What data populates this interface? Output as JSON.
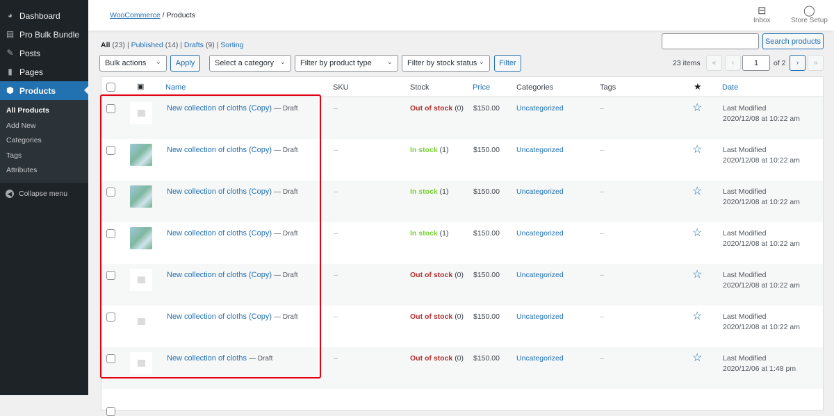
{
  "sidebar": {
    "items": [
      {
        "label": "Dashboard",
        "icon": "dashboard-icon"
      },
      {
        "label": "Pro Bulk Bundle",
        "icon": "bundle-icon"
      },
      {
        "label": "Posts",
        "icon": "pin-icon"
      },
      {
        "label": "Pages",
        "icon": "pages-icon"
      },
      {
        "label": "Products",
        "icon": "box-icon"
      }
    ],
    "submenu": [
      "All Products",
      "Add New",
      "Categories",
      "Tags",
      "Attributes"
    ],
    "collapse": "Collapse menu"
  },
  "header": {
    "breadcrumb_link": "WooCommerce",
    "breadcrumb_sep": "/",
    "breadcrumb_current": "Products",
    "inbox": "Inbox",
    "store_setup": "Store Setup"
  },
  "views": {
    "all": "All",
    "all_count": "(23)",
    "published": "Published",
    "published_count": "(14)",
    "drafts": "Drafts",
    "drafts_count": "(9)",
    "sorting": "Sorting"
  },
  "search": {
    "value": "",
    "button": "Search products"
  },
  "filters": {
    "bulk": "Bulk actions",
    "apply": "Apply",
    "category": "Select a category",
    "type": "Filter by product type",
    "stock": "Filter by stock status",
    "filter": "Filter"
  },
  "pagination": {
    "items": "23 items",
    "first": "«",
    "prev": "‹",
    "page": "1",
    "of": "of 2",
    "next": "›",
    "last": "»"
  },
  "columns": {
    "name": "Name",
    "sku": "SKU",
    "stock": "Stock",
    "price": "Price",
    "categories": "Categories",
    "tags": "Tags",
    "date": "Date"
  },
  "rows": [
    {
      "name": "New collection of cloths (Copy)",
      "state": "— Draft",
      "sku": "–",
      "stock": "Out of stock",
      "qty": "(0)",
      "in": false,
      "img": false,
      "price": "$150.00",
      "cat": "Uncategorized",
      "tags": "–",
      "d1": "Last Modified",
      "d2": "2020/12/08 at 10:22 am"
    },
    {
      "name": "New collection of cloths (Copy)",
      "state": "— Draft",
      "sku": "–",
      "stock": "In stock",
      "qty": "(1)",
      "in": true,
      "img": true,
      "price": "$150.00",
      "cat": "Uncategorized",
      "tags": "–",
      "d1": "Last Modified",
      "d2": "2020/12/08 at 10:22 am"
    },
    {
      "name": "New collection of cloths (Copy)",
      "state": "— Draft",
      "sku": "–",
      "stock": "In stock",
      "qty": "(1)",
      "in": true,
      "img": true,
      "price": "$150.00",
      "cat": "Uncategorized",
      "tags": "–",
      "d1": "Last Modified",
      "d2": "2020/12/08 at 10:22 am"
    },
    {
      "name": "New collection of cloths (Copy)",
      "state": "— Draft",
      "sku": "–",
      "stock": "In stock",
      "qty": "(1)",
      "in": true,
      "img": true,
      "price": "$150.00",
      "cat": "Uncategorized",
      "tags": "–",
      "d1": "Last Modified",
      "d2": "2020/12/08 at 10:22 am"
    },
    {
      "name": "New collection of cloths (Copy)",
      "state": "— Draft",
      "sku": "–",
      "stock": "Out of stock",
      "qty": "(0)",
      "in": false,
      "img": false,
      "price": "$150.00",
      "cat": "Uncategorized",
      "tags": "–",
      "d1": "Last Modified",
      "d2": "2020/12/08 at 10:22 am"
    },
    {
      "name": "New collection of cloths (Copy)",
      "state": "— Draft",
      "sku": "–",
      "stock": "Out of stock",
      "qty": "(0)",
      "in": false,
      "img": false,
      "price": "$150.00",
      "cat": "Uncategorized",
      "tags": "–",
      "d1": "Last Modified",
      "d2": "2020/12/08 at 10:22 am"
    },
    {
      "name": "New collection of cloths",
      "state": "— Draft",
      "sku": "–",
      "stock": "Out of stock",
      "qty": "(0)",
      "in": false,
      "img": false,
      "price": "$150.00",
      "cat": "Uncategorized",
      "tags": "–",
      "d1": "Last Modified",
      "d2": "2020/12/06 at 1:48 pm"
    }
  ]
}
